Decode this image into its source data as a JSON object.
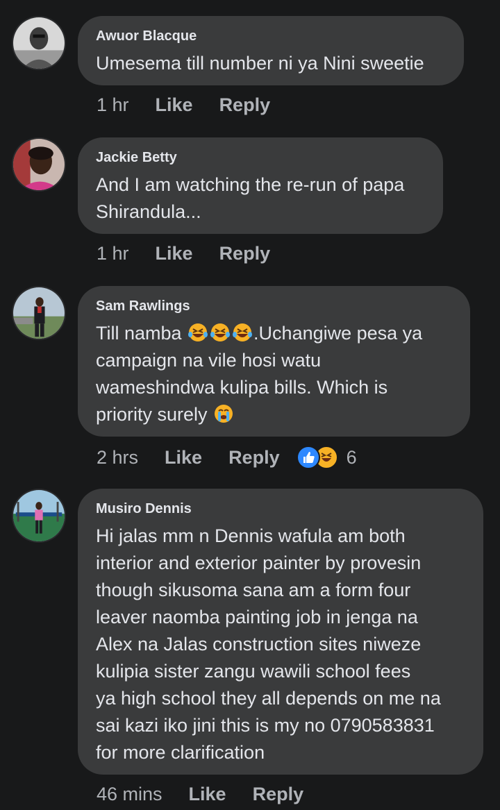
{
  "comments": [
    {
      "author": "Awuor Blacque",
      "text": [
        "Umesema till number ni ya Nini sweetie"
      ],
      "time": "1 hr",
      "like_label": "Like",
      "reply_label": "Reply"
    },
    {
      "author": "Jackie Betty",
      "text": [
        "And I am watching the re-run of papa",
        "Shirandula..."
      ],
      "time": "1 hr",
      "like_label": "Like",
      "reply_label": "Reply"
    },
    {
      "author": "Sam Rawlings",
      "text": [
        "Till namba ",
        ".Uchangiwe pesa ya",
        "campaign na vile hosi watu",
        "wameshindwa kulipa bills. Which is",
        "priority surely "
      ],
      "emojis": [
        "rofl-emoji",
        "rofl-emoji",
        "rofl-emoji",
        "crying-emoji"
      ],
      "time": "2 hrs",
      "like_label": "Like",
      "reply_label": "Reply",
      "reactions": [
        "like-reaction-icon",
        "haha-reaction-icon"
      ],
      "reaction_count": "6"
    },
    {
      "author": "Musiro Dennis",
      "text": [
        "Hi jalas mm n Dennis wafula am both",
        "interior and exterior  painter by provesin",
        "though sikusoma sana am a form four",
        "leaver naomba painting job in jenga na",
        "Alex na Jalas  construction sites  niweze",
        "kulipia sister zangu wawili  school fees",
        "ya high school they all depends on me na",
        "sai kazi iko jini  this is my no 0790583831",
        "for more clarification"
      ],
      "time": "46 mins",
      "like_label": "Like",
      "reply_label": "Reply"
    }
  ],
  "colors": {
    "background": "#18191a",
    "bubble": "#3a3b3c",
    "text": "#e4e6eb",
    "meta": "#b0b3b8",
    "like_blue": "#2d88ff",
    "haha_yellow": "#f7b125"
  }
}
